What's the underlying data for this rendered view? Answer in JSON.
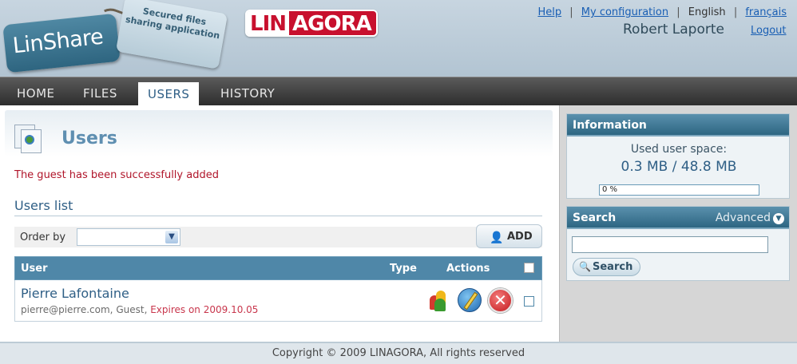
{
  "header": {
    "logo_text": "LinShare",
    "tagline": "Secured files sharing application",
    "brand_left": "LIN",
    "brand_right": "AGORA",
    "links": {
      "help": "Help",
      "config": "My configuration",
      "lang_current": "English",
      "lang_other": "français",
      "sep": "|"
    },
    "user_name": "Robert Laporte",
    "logout": "Logout"
  },
  "nav": {
    "tabs": [
      {
        "label": "HOME",
        "active": false
      },
      {
        "label": "FILES",
        "active": false
      },
      {
        "label": "USERS",
        "active": true
      },
      {
        "label": "HISTORY",
        "active": false
      }
    ]
  },
  "main": {
    "title": "Users",
    "message": "The guest has been successfully added",
    "list_title": "Users list",
    "order_label": "Order by",
    "order_value": "",
    "add_label": "ADD",
    "table": {
      "headers": {
        "user": "User",
        "type": "Type",
        "actions": "Actions"
      },
      "rows": [
        {
          "name": "Pierre Lafontaine",
          "email": "pierre@pierre.com",
          "role": "Guest",
          "expires": "Expires on 2009.10.05"
        }
      ]
    }
  },
  "sidebar": {
    "info": {
      "title": "Information",
      "label": "Used user space:",
      "value": "0.3 MB / 48.8 MB",
      "progress_percent": 0,
      "progress_text": "0 %"
    },
    "search": {
      "title": "Search",
      "advanced": "Advanced",
      "input_value": "",
      "button": "Search"
    }
  },
  "footer": {
    "text": "Copyright © 2009 LINAGORA, All rights reserved"
  },
  "colors": {
    "accent": "#4f87a8",
    "brand_red": "#c8102e",
    "message_red": "#b0152a",
    "nav_dark": "#2d2d2d"
  }
}
